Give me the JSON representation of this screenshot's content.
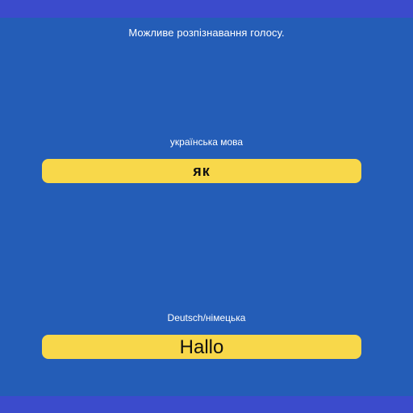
{
  "hint": "Можливе розпізнавання голосу.",
  "source": {
    "language_label": "українська мова",
    "word": "як"
  },
  "target": {
    "language_label": "Deutsch/німецька",
    "word": "Hallo"
  },
  "colors": {
    "background": "#245db7",
    "bars": "#3b4bcc",
    "word_box": "#f8d84a"
  }
}
